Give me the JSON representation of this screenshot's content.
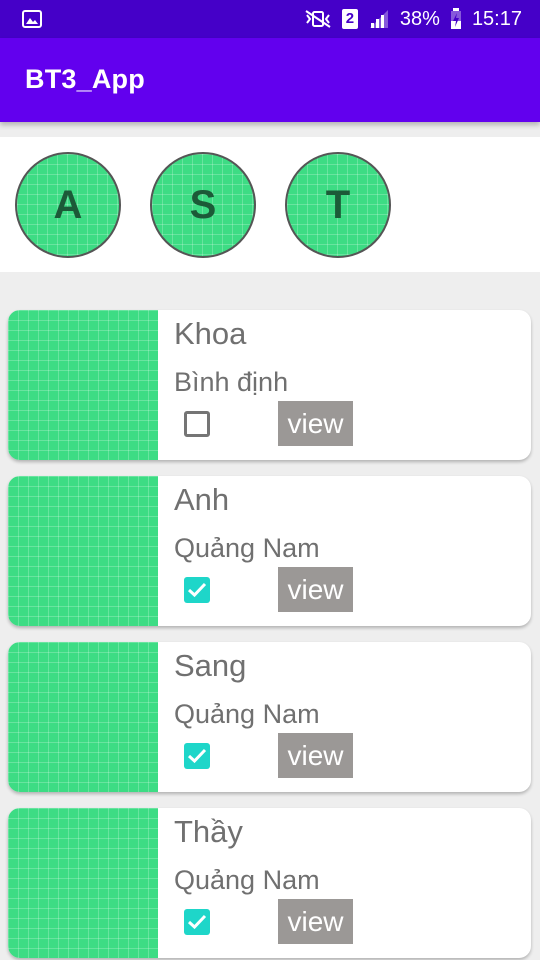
{
  "status_bar": {
    "battery": "38%",
    "time": "15:17",
    "sim_badge": "2",
    "icons": [
      "image-icon",
      "mute-vibrate-icon",
      "sim-2-icon",
      "signal-icon",
      "battery-charging-icon"
    ]
  },
  "app_bar": {
    "title": "BT3_App"
  },
  "avatars": [
    {
      "letter": "A"
    },
    {
      "letter": "S"
    },
    {
      "letter": "T"
    }
  ],
  "contacts": [
    {
      "name": "Khoa",
      "place": "Bình định",
      "checked": false,
      "button": "view"
    },
    {
      "name": "Anh",
      "place": "Quảng Nam",
      "checked": true,
      "button": "view"
    },
    {
      "name": "Sang",
      "place": "Quảng Nam",
      "checked": true,
      "button": "view"
    },
    {
      "name": "Thầy",
      "place": "Quảng Nam",
      "checked": true,
      "button": "view"
    }
  ],
  "colors": {
    "status_bar": "#4500c8",
    "app_bar": "#6200ee",
    "avatar_green": "#3ddc84",
    "checkbox_checked": "#1ed6c9",
    "view_button": "#9b9896"
  }
}
